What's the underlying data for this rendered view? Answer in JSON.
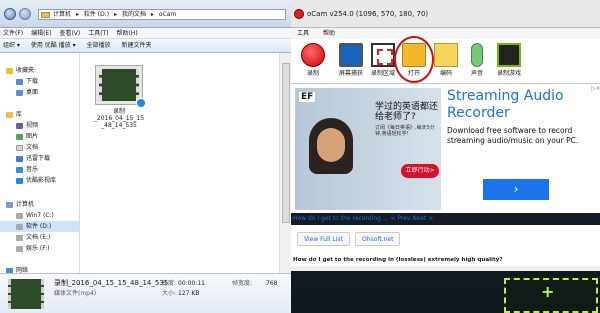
{
  "explorer": {
    "breadcrumbs": [
      "计算机",
      "▸",
      "软件 (D:)",
      "▸",
      "我的文档",
      "▸",
      "oCam"
    ],
    "menu": [
      "文件(F)",
      "编辑(E)",
      "查看(V)",
      "工具(T)",
      "帮助(H)"
    ],
    "toolbar": [
      "组织 ▾",
      "使用 优酷 播放 ▾",
      "全部播放",
      "新建文件夹"
    ],
    "nav": {
      "favorites": "收藏夹",
      "downloads": "下载",
      "desktop": "桌面",
      "library": "库",
      "videos": "视频",
      "pictures": "图片",
      "documents": "文档",
      "thunder": "迅雷下载",
      "music": "音乐",
      "youku": "优酷影视库",
      "computer": "计算机",
      "win7": "Win7 (C:)",
      "soft_d": "软件 (D:)",
      "doc_e": "文档 (E:)",
      "ent_f": "娱乐 (F:)",
      "network": "网络"
    },
    "file": {
      "name": "录制\n_2016_04_15_15\n_48_14_535"
    },
    "details": {
      "filename": "录制_2016_04_15_15_48_14_535",
      "type": "媒体文件(mp4)",
      "length_label": "长度:",
      "length": "00:00:11",
      "size_label": "大小:",
      "size": "127 KB",
      "framewidth_label": "帧宽度:",
      "framewidth": "768"
    }
  },
  "ocam": {
    "title": "oCam v254.0 (1096, 570, 180, 70)",
    "menu": [
      "工具",
      "帮助"
    ],
    "tools": [
      "录制",
      "屏幕捕获",
      "录制区域",
      "打开",
      "编码",
      "声音",
      "录制游戏"
    ],
    "ad": {
      "logo": "EF",
      "cn_head": "学过的英语都还给老师了?",
      "cn_sub": "订阅《每日英语》,每天5分钟,英语轻松学!",
      "cn_button": "立即行动>",
      "headline": "Streaming Audio Recorder",
      "body": "Download free software to record streaming audio/music on your PC.",
      "go": "›",
      "close": "▷×"
    },
    "links": "How do I get to the recording ...  < Prev Next >",
    "buttons": [
      "View Full List",
      "Ohsoft.net"
    ],
    "faq": "How do I get to the recording in (lossless) extremely high quality?"
  },
  "overlay": {
    "plus": "+"
  },
  "colors": {
    "accent": "#1a73e8",
    "highlight": "#d01010",
    "crop": "#c8f02a"
  }
}
